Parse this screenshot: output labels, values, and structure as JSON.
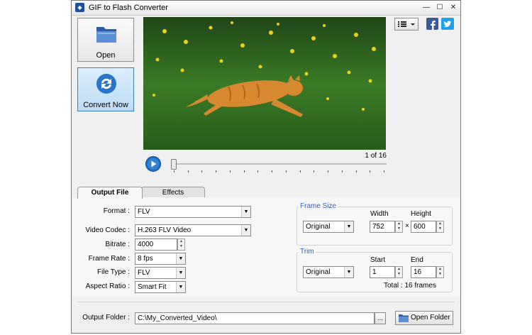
{
  "window": {
    "title": "GIF to Flash Converter"
  },
  "sidebar": {
    "open_label": "Open",
    "convert_label": "Convert Now"
  },
  "player": {
    "frame_counter": "1 of 16",
    "position_fraction": 0.0
  },
  "tabs": [
    {
      "label": "Output File"
    },
    {
      "label": "Effects"
    }
  ],
  "output": {
    "format_label": "Format :",
    "format_value": "FLV",
    "codec_label": "Video Codec :",
    "codec_value": "H.263 FLV Video",
    "bitrate_label": "Bitrate :",
    "bitrate_value": "4000",
    "framerate_label": "Frame Rate :",
    "framerate_value": "8 fps",
    "filetype_label": "File Type :",
    "filetype_value": "FLV",
    "aspect_label": "Aspect Ratio :",
    "aspect_value": "Smart Fit"
  },
  "frame_size": {
    "title": "Frame Size",
    "mode": "Original",
    "width_label": "Width",
    "width_value": "752",
    "times": "×",
    "height_label": "Height",
    "height_value": "600"
  },
  "trim": {
    "title": "Trim",
    "mode": "Original",
    "start_label": "Start",
    "start_value": "1",
    "end_label": "End",
    "end_value": "16",
    "total": "Total : 16 frames"
  },
  "folder": {
    "label": "Output Folder :",
    "path": "C:\\My_Converted_Video\\",
    "browse_label": "...",
    "open_label": "Open Folder"
  },
  "colors": {
    "accent": "#3a5fb0",
    "facebook": "#3b5998",
    "twitter": "#1da1f2",
    "play": "#1f6fc1"
  },
  "icons": [
    "app-icon",
    "folder-icon",
    "convert-refresh-icon",
    "menu-list-icon",
    "facebook-icon",
    "twitter-icon",
    "play-icon",
    "folder-small-icon"
  ]
}
